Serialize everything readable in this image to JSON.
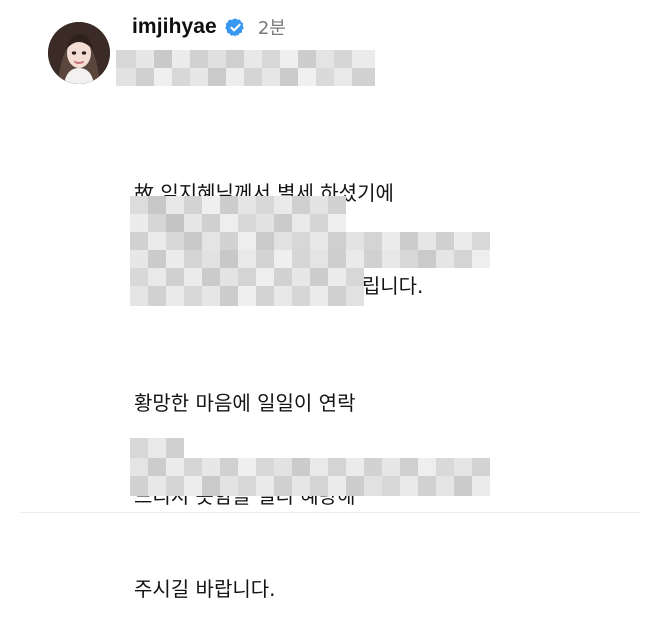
{
  "post": {
    "username": "imjihyae",
    "time": "2분",
    "paragraph1": [
      "故 임지혜님께서 별세 하셨기에",
      "아래와 같이 부고를 전해 드립니다."
    ],
    "paragraph2": [
      "황망한 마음에 일일이 연락",
      "드리지 못함을 널리 혜량해",
      "주시길 바랍니다."
    ]
  },
  "colors": {
    "verified_badge": "#3897f0",
    "username_text": "#0f0f0f",
    "time_text": "#7a7a7a",
    "body_text": "#141414"
  },
  "icons": {
    "verified": "verified-badge-icon",
    "avatar": "profile-avatar"
  }
}
